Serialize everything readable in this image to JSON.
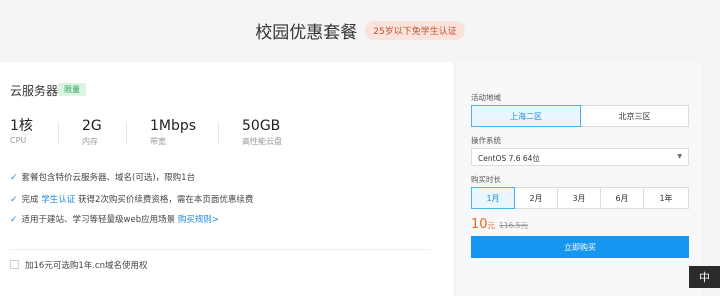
{
  "header": {
    "title": "校园优惠套餐",
    "tag": "25岁以下免学生认证"
  },
  "plan": {
    "title": "云服务器",
    "badge": "限量",
    "specs": [
      {
        "value": "1核",
        "unit": "CPU"
      },
      {
        "value": "2G",
        "unit": "内存"
      },
      {
        "value": "1Mbps",
        "unit": "带宽"
      },
      {
        "value": "50GB",
        "unit": "高性能云盘"
      }
    ],
    "features": {
      "f1": "套餐包含特价云服务器、域名(可选)，限购1台",
      "f2_pre": "完成 ",
      "f2_link": "学生认证",
      "f2_post": " 获得2次购买价续费资格，需在本页面优惠续费",
      "f3_pre": "适用于建站、学习等轻量级web应用场景 ",
      "f3_link": "购买规则>"
    },
    "checkbox_label": "加16元可选购1年.cn域名使用权"
  },
  "panel": {
    "region_label": "活动地域",
    "regions": [
      "上海二区",
      "北京三区"
    ],
    "os_label": "操作系统",
    "os_value": "CentOS 7.6 64位",
    "duration_label": "购买时长",
    "durations": [
      "1月",
      "2月",
      "3月",
      "6月",
      "1年"
    ],
    "price": "10",
    "price_unit": "元",
    "price_old": "116.5元",
    "buy_label": "立即购买"
  },
  "lang_button": "中",
  "colors": {
    "accent": "#1596f1",
    "price": "#f0661d",
    "badge_green": "#2aa15a"
  }
}
